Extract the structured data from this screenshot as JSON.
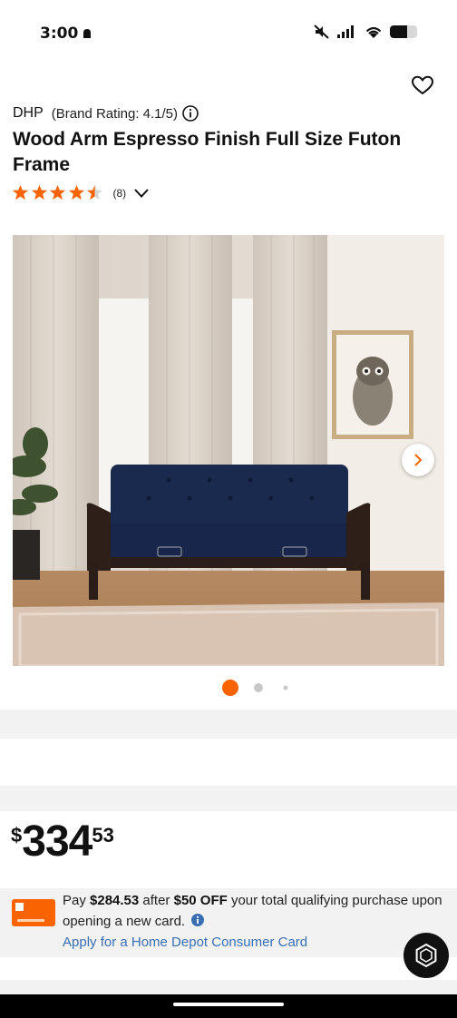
{
  "status_bar": {
    "time": "3:00"
  },
  "product": {
    "brand": "DHP",
    "brand_rating": "(Brand Rating: 4.1/5)",
    "title": "Wood Arm Espresso Finish Full Size Futon Frame",
    "rating": 4.5,
    "review_count": "(8)"
  },
  "gallery": {
    "image_count": 3,
    "current_index": 0
  },
  "price": {
    "currency": "$",
    "dollars": "334",
    "cents": "53"
  },
  "promo": {
    "text_pay": "Pay ",
    "amount": "$284.53",
    "text_after": " after ",
    "discount": "$50 OFF",
    "text_rest": " your total qualifying purchase upon opening a new card.",
    "link": "Apply for a Home Depot Consumer Card"
  },
  "colors": {
    "accent": "#f96302",
    "star": "#f96302",
    "link": "#3a6fb3",
    "futon": "#17264a"
  },
  "icons": [
    "heart-icon",
    "info-icon",
    "star-icon",
    "chevron-down-icon",
    "chevron-right-icon",
    "chat-icon"
  ]
}
